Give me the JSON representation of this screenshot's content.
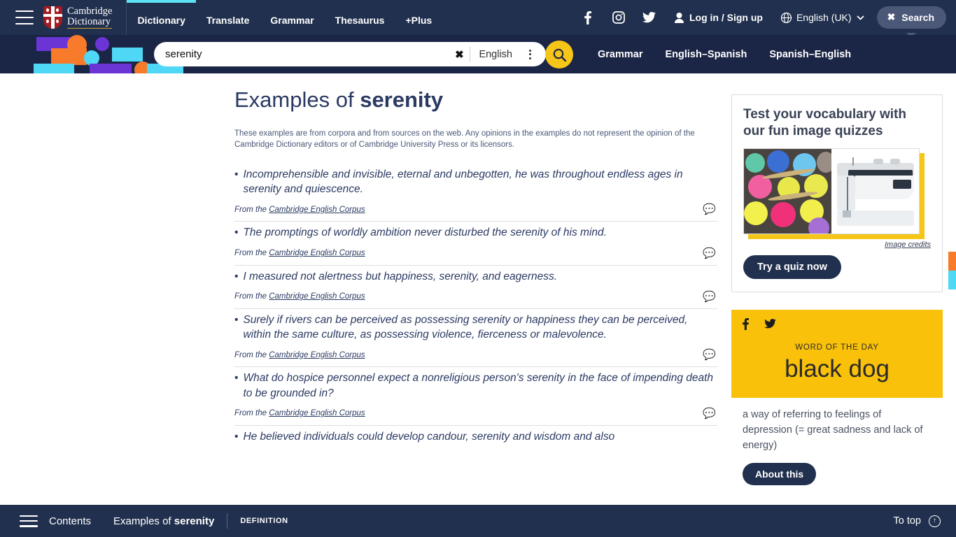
{
  "topnav": {
    "menu_label": "Menu",
    "brand_line1": "Cambridge",
    "brand_line2": "Dictionary",
    "links": [
      {
        "label": "Dictionary",
        "active": true
      },
      {
        "label": "Translate",
        "active": false
      },
      {
        "label": "Grammar",
        "active": false
      },
      {
        "label": "Thesaurus",
        "active": false
      },
      {
        "label": "+Plus",
        "active": false
      }
    ],
    "social": [
      "facebook-icon",
      "instagram-icon",
      "twitter-icon"
    ],
    "login_label": "Log in / Sign up",
    "language_label": "English (UK)",
    "search_button_label": "Search"
  },
  "searchbar": {
    "value": "serenity",
    "placeholder": "Search",
    "clear_label": "✖",
    "lang_label": "English",
    "go_icon": "search-icon",
    "quicklinks": [
      {
        "label": "Grammar"
      },
      {
        "label": "English–Spanish"
      },
      {
        "label": "Spanish–English"
      }
    ]
  },
  "main": {
    "title_prefix": "Examples of ",
    "title_word": "serenity",
    "disclaimer": "These examples are from corpora and from sources on the web. Any opinions in the examples do not represent the opinion of the Cambridge Dictionary editors or of Cambridge University Press or its licensors.",
    "from_the": "From the ",
    "examples": [
      {
        "text": "Incomprehensible and invisible, eternal and unbegotten, he was throughout endless ages in serenity and quiescence.",
        "source": "Cambridge English Corpus"
      },
      {
        "text": "The promptings of worldly ambition never disturbed the serenity of his mind.",
        "source": "Cambridge English Corpus"
      },
      {
        "text": "I measured not alertness but happiness, serenity, and eagerness.",
        "source": "Cambridge English Corpus"
      },
      {
        "text": "Surely if rivers can be perceived as possessing serenity or happiness they can be perceived, within the same culture, as possessing violence, fierceness or malevolence.",
        "source": "Cambridge English Corpus"
      },
      {
        "text": "What do hospice personnel expect a nonreligious person's serenity in the face of impending death to be grounded in?",
        "source": "Cambridge English Corpus"
      },
      {
        "text": "He believed individuals could develop candour, serenity and wisdom and also",
        "source": ""
      }
    ]
  },
  "sidebar": {
    "quiz": {
      "title": "Test your vocabulary with our fun image quizzes",
      "image_credits_label": "Image credits",
      "cta_label": "Try a quiz now"
    },
    "wotd": {
      "label": "WORD OF THE DAY",
      "word": "black dog",
      "definition": "a way of referring to feelings of depression (= great sadness and lack of energy)",
      "about_label": "About this",
      "social": [
        "facebook-icon",
        "twitter-icon"
      ]
    }
  },
  "bottombar": {
    "contents_label": "Contents",
    "crumb_prefix": "Examples of ",
    "crumb_word": "serenity",
    "definition_label": "DEFINITION",
    "totop_label": "To top"
  },
  "colors": {
    "navy": "#21304e",
    "deep_navy": "#1b2545",
    "cyan_accent": "#5ce1f2",
    "yellow": "#f9c10a",
    "gold": "#f5c518",
    "orange": "#f77b2b",
    "purple": "#6b35d6",
    "text_navy": "#2b3a63"
  }
}
